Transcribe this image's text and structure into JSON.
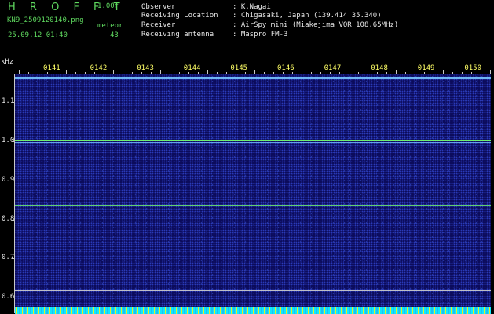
{
  "header": {
    "app_title": "H R O F F T",
    "version": "1.00f",
    "filename": "KN9_2509120140.png",
    "meteor_label": "meteor",
    "datetime": "25.09.12 01:40",
    "meteor_count": "43"
  },
  "info": {
    "observer_label": "Observer",
    "observer": ": K.Nagai",
    "location_label": "Receiving Location",
    "location": ": Chigasaki, Japan (139.414 35.340)",
    "receiver_label": "Receiver",
    "receiver": ": AirSpy mini (Miakejima VOR 108.65MHz)",
    "antenna_label": "Receiving antenna",
    "antenna": ": Maspro FM-3"
  },
  "chart_data": {
    "type": "heatmap",
    "ylabel": "kHz",
    "y_ticks": [
      "1.1",
      "1.0",
      "0.9",
      "0.8",
      "0.7",
      "0.6"
    ],
    "x_ticks": [
      "0141",
      "0142",
      "0143",
      "0144",
      "0145",
      "0146",
      "0147",
      "0148",
      "0149",
      "0150"
    ],
    "ylim": [
      0.6,
      1.15
    ],
    "horizontal_lines_khz": [
      1.165,
      1.005,
      0.998,
      0.965,
      0.837,
      0.618
    ],
    "colors": {
      "background": "#0c0c5c",
      "carrier": "#70f070",
      "trace": "#78c8ff",
      "noise": "#2a3ab8"
    }
  }
}
